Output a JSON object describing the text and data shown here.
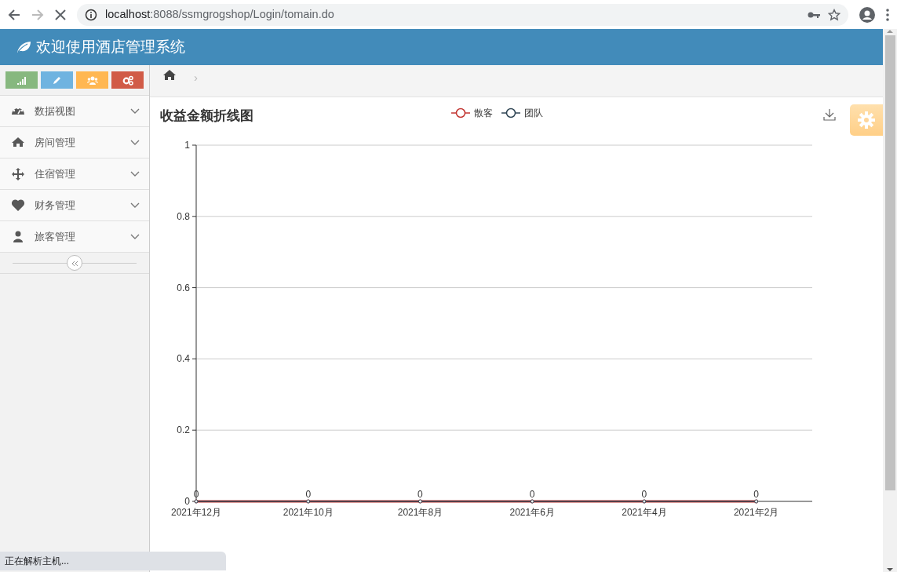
{
  "browser": {
    "url_host": "localhost",
    "url_path": ":8088/ssmgrogshop/Login/tomain.do",
    "loading": true
  },
  "header": {
    "title": "欢迎使用酒店管理系统"
  },
  "shortcuts": [
    {
      "kind": "signal",
      "color": "#87b87f"
    },
    {
      "kind": "pencil",
      "color": "#6fb3e0"
    },
    {
      "kind": "users",
      "color": "#ffb752"
    },
    {
      "kind": "cogs",
      "color": "#d15b47"
    }
  ],
  "sidebar": {
    "items": [
      {
        "kind": "dashboard",
        "label": "数据视图",
        "expanded": false
      },
      {
        "kind": "home",
        "label": "房间管理",
        "expanded": false
      },
      {
        "kind": "move",
        "label": "住宿管理",
        "expanded": false
      },
      {
        "kind": "heart",
        "label": "财务管理",
        "expanded": false
      },
      {
        "kind": "user",
        "label": "旅客管理",
        "expanded": false
      }
    ]
  },
  "breadcrumb": {
    "separator": "›"
  },
  "chart": {
    "title": "收益金额折线图",
    "chart_data": {
      "type": "line",
      "categories": [
        "2021年12月",
        "2021年10月",
        "2021年8月",
        "2021年6月",
        "2021年4月",
        "2021年2月"
      ],
      "series": [
        {
          "name": "散客",
          "color": "#c23531",
          "marker": "circle",
          "values": [
            0,
            0,
            0,
            0,
            0,
            0
          ],
          "value_labels": [
            "0",
            "0",
            "0",
            "0",
            "0",
            "0"
          ]
        },
        {
          "name": "团队",
          "color": "#2f4554",
          "marker": "circle",
          "values": [
            0,
            0,
            0,
            0,
            0,
            0
          ],
          "value_labels": [
            null,
            null,
            null,
            null,
            null,
            null
          ]
        }
      ],
      "grid": true,
      "ylim": [
        0,
        1
      ],
      "yticks": [
        0,
        0.2,
        0.4,
        0.6,
        0.8,
        1
      ]
    }
  },
  "status_bar": {
    "text": "正在解析主机..."
  }
}
